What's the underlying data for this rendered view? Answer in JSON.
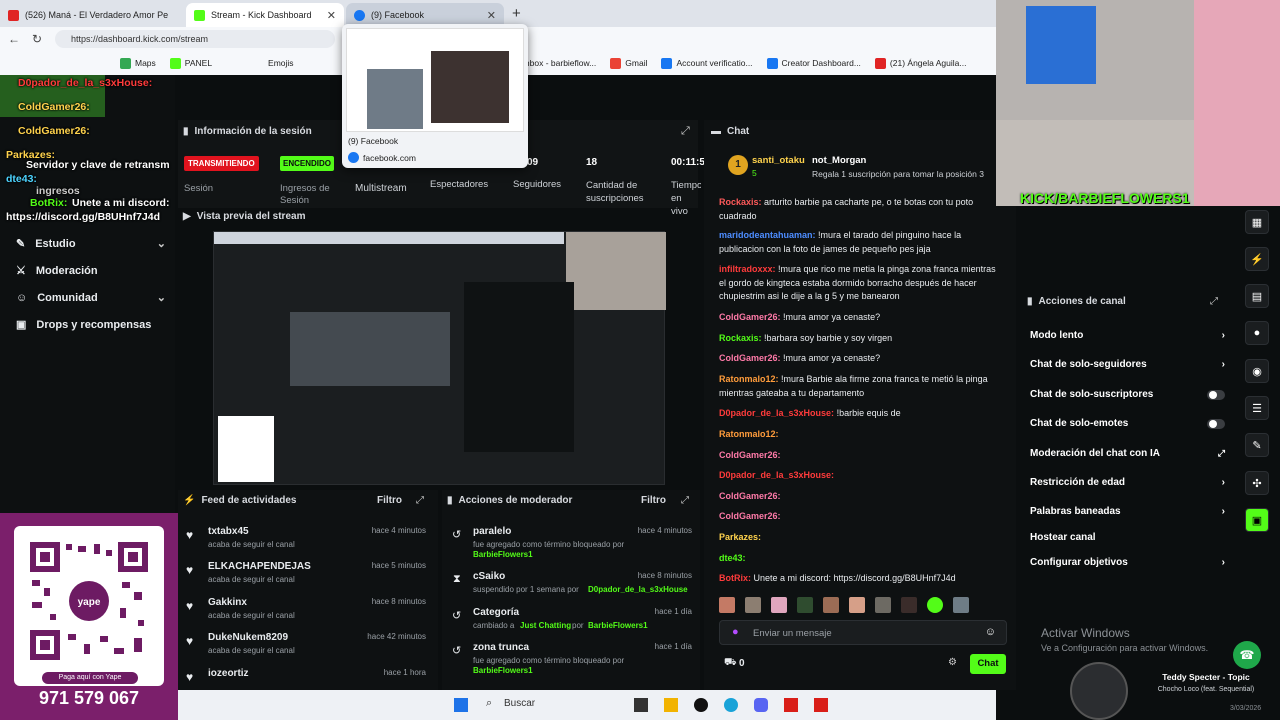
{
  "browser": {
    "tabs": [
      {
        "label": "(526) Maná - El Verdadero Amor Pe"
      },
      {
        "label": "Stream - Kick Dashboard"
      },
      {
        "label": "(9) Facebook"
      }
    ],
    "url": "https://dashboard.kick.com/stream",
    "bookmarks": [
      "Maps",
      "PANEL",
      "Emojis",
      "Inbox - barbieflow...",
      "Gmail",
      "Account verificatio...",
      "Creator Dashboard...",
      "(21) Ángela Aguila..."
    ],
    "hover_preview": {
      "title": "(9) Facebook",
      "domain": "facebook.com"
    }
  },
  "overlay_chat": [
    {
      "user": "D0pador_de_la_s3xHouse:",
      "text": ""
    },
    {
      "user": "ColdGamer26:",
      "text": ""
    },
    {
      "user": "ColdGamer26:",
      "text": ""
    },
    {
      "user": "Parkazes:",
      "text": ""
    },
    {
      "user": "",
      "text": "Servidor y clave de retransm"
    },
    {
      "user": "dte43:",
      "text": ""
    },
    {
      "user": "",
      "text": "ingresos"
    },
    {
      "user": "BotRix:",
      "text": "Unete a mi discord:"
    },
    {
      "user": "",
      "text": "https://discord.gg/B8UHnf7J4d"
    }
  ],
  "sidebar": {
    "items": [
      {
        "label": "Estudio",
        "has_chevron": true
      },
      {
        "label": "Moderación",
        "has_chevron": false
      },
      {
        "label": "Comunidad",
        "has_chevron": true
      },
      {
        "label": "Drops y recompensas",
        "has_chevron": false
      }
    ]
  },
  "yape": {
    "caption": "Paga aquí con Yape",
    "phone": "971 579 067",
    "small_phone": "971 579 067"
  },
  "session": {
    "title": "Información de la sesión",
    "live_badge": "TRANSMITIENDO",
    "on_badge": "ENCENDIDO",
    "stats": [
      {
        "label": "Sesión",
        "value": ""
      },
      {
        "label": "Ingresos de Sesión",
        "value": ""
      },
      {
        "label": "Multistream",
        "value": ""
      },
      {
        "label": "Espectadores",
        "value": "09"
      },
      {
        "label": "Seguidores",
        "value": "18"
      },
      {
        "label": "Cantidad de suscripciones",
        "value": ""
      },
      {
        "label": "Tiempo en vivo",
        "value": "00:11:5"
      }
    ]
  },
  "preview": {
    "title": "Vista previa del stream"
  },
  "feed": {
    "title": "Feed de actividades",
    "filter": "Filtro",
    "items": [
      {
        "user": "txtabx45",
        "text": "acaba de seguir el canal",
        "time": "hace 4 minutos"
      },
      {
        "user": "ELKACHAPENDEJAS",
        "text": "acaba de seguir el canal",
        "time": "hace 5 minutos"
      },
      {
        "user": "Gakkinx",
        "text": "acaba de seguir el canal",
        "time": "hace 8 minutos"
      },
      {
        "user": "DukeNukem8209",
        "text": "acaba de seguir el canal",
        "time": "hace 42 minutos"
      },
      {
        "user": "iozeortiz",
        "text": "",
        "time": "hace 1 hora"
      }
    ]
  },
  "modactions": {
    "title": "Acciones de moderador",
    "filter": "Filtro",
    "items": [
      {
        "title": "paralelo",
        "line1": "fue agregado como término bloqueado por",
        "by": "BarbieFlowers1",
        "time": "hace 4 minutos"
      },
      {
        "title": "cSaiko",
        "line1": "suspendido por 1 semana por",
        "by": "D0pador_de_la_s3xHouse",
        "time": "hace 8 minutos"
      },
      {
        "title": "Categoría",
        "line1": "cambiado a",
        "by": "Just Chatting",
        "line1b": "por",
        "by2": "BarbieFlowers1",
        "time": "hace 1 día"
      },
      {
        "title": "zona trunca",
        "line1": "fue agregado como término bloqueado por",
        "by": "BarbieFlowers1",
        "time": "hace 1 día"
      }
    ]
  },
  "chat": {
    "title": "Chat",
    "pinned_user": "santi_otaku",
    "pinned_count": "5",
    "gift_user": "not_Morgan",
    "gift_text": "Regala 1 suscripción para tomar la posición 3",
    "messages": [
      {
        "user": "Rockaxis:",
        "text": "arturito barbie pa cacharte pe, o te botas con tu poto cuadrado",
        "color": "#ff5a5a"
      },
      {
        "user": "maridodeantahuaman:",
        "text": "!mura el tarado del pinguino hace la publicacion con la foto de james de pequeño pes jaja",
        "color": "#4d8dff"
      },
      {
        "user": "infiltradoxxx:",
        "text": "!mura que rico me metia la pinga zona franca mientras el gordo de kingteca estaba dormido borracho después de hacer chupiestrim asi le dije a la g 5 y me banearon",
        "color": "#ff3b3b"
      },
      {
        "user": "ColdGamer26:",
        "text": "!mura amor ya cenaste?",
        "color": "#ff7aa8"
      },
      {
        "user": "Rockaxis:",
        "text": "!barbara soy barbie y soy virgen",
        "color": "#53fc18"
      },
      {
        "user": "ColdGamer26:",
        "text": "!mura amor ya cenaste?",
        "color": "#ff7aa8"
      },
      {
        "user": "Ratonmalo12:",
        "text": "!mura Barbie ala firme zona franca te metió la pinga mientras gateaba a tu departamento",
        "color": "#ff9c3b"
      },
      {
        "user": "D0pador_de_la_s3xHouse:",
        "text": "!barbie equis de",
        "color": "#ff3b3b"
      },
      {
        "user": "Ratonmalo12:",
        "text": "",
        "color": "#ff9c3b"
      },
      {
        "user": "ColdGamer26:",
        "text": "",
        "color": "#ff7aa8"
      },
      {
        "user": "D0pador_de_la_s3xHouse:",
        "text": "",
        "color": "#ff3b3b"
      },
      {
        "user": "ColdGamer26:",
        "text": "",
        "color": "#ff7aa8"
      },
      {
        "user": "ColdGamer26:",
        "text": "",
        "color": "#ff7aa8"
      },
      {
        "user": "Parkazes:",
        "text": "",
        "color": "#ffd34d"
      },
      {
        "user": "dte43:",
        "text": "",
        "color": "#53fc18"
      },
      {
        "user": "BotRix:",
        "text": "Unete a mi discord: https://discord.gg/B8UHnf7J4d",
        "color": "#ff3b3b"
      }
    ],
    "input_placeholder": "Enviar un mensaje",
    "points": "0",
    "send_label": "Chat"
  },
  "channel_actions": {
    "title": "Acciones de canal",
    "items": [
      {
        "label": "Modo lento",
        "control": "chevron"
      },
      {
        "label": "Chat de solo-seguidores",
        "control": "chevron"
      },
      {
        "label": "Chat de solo-suscriptores",
        "control": "toggle"
      },
      {
        "label": "Chat de solo-emotes",
        "control": "toggle"
      },
      {
        "label": "Moderación del chat con IA",
        "control": "external"
      },
      {
        "label": "Restricción de edad",
        "control": "chevron"
      },
      {
        "label": "Palabras baneadas",
        "control": "chevron"
      },
      {
        "label": "Hostear canal",
        "control": "none"
      },
      {
        "label": "Configurar objetivos",
        "control": "chevron"
      }
    ]
  },
  "webcam": {
    "banner": "KICK/BARBIEFLOWERS1"
  },
  "windows": {
    "activate_title": "Activar Windows",
    "activate_sub": "Ve a Configuración para activar Windows."
  },
  "taskbar": {
    "search": "Buscar"
  },
  "music": {
    "title": "Teddy Specter - Topic",
    "subtitle": "Chocho Loco (feat. Sequential)",
    "date": "3/03/2026"
  },
  "colors": {
    "kick_green": "#53fc18",
    "live_red": "#e1131e",
    "bg": "#0b0e0f"
  }
}
